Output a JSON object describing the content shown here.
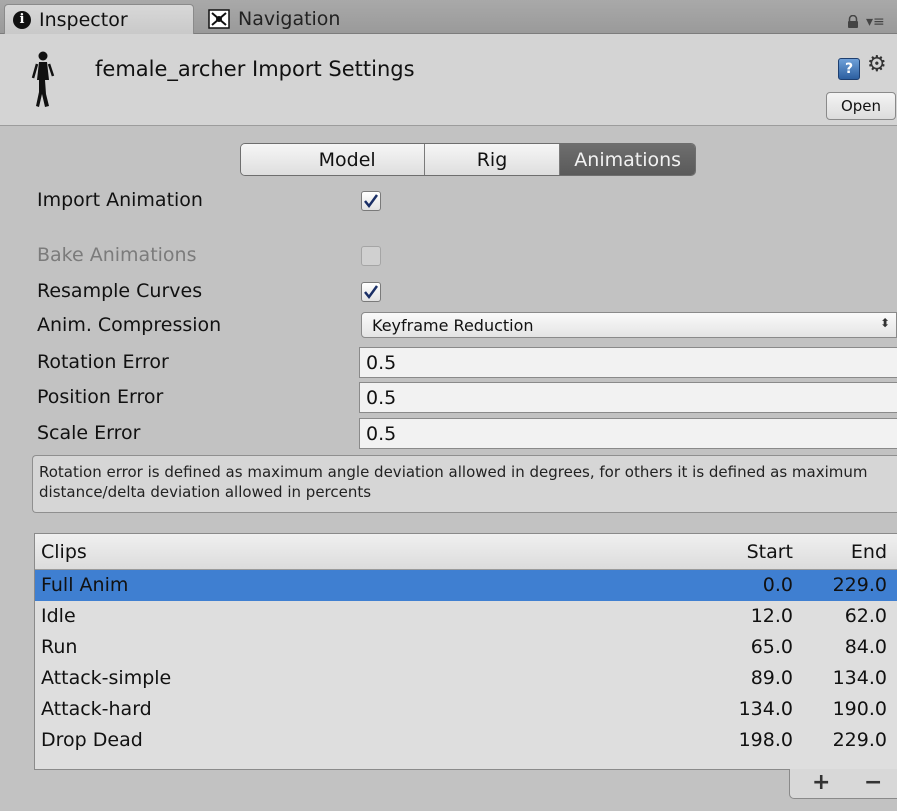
{
  "tabs": [
    {
      "label": "Inspector",
      "icon": "info-icon",
      "active": true
    },
    {
      "label": "Navigation",
      "icon": "navigation-icon",
      "active": false
    }
  ],
  "header": {
    "title": "female_archer Import Settings",
    "open_label": "Open",
    "help_glyph": "?"
  },
  "segments": [
    {
      "label": "Model",
      "active": false
    },
    {
      "label": "Rig",
      "active": false
    },
    {
      "label": "Animations",
      "active": true
    }
  ],
  "properties": {
    "import_animation": {
      "label": "Import Animation",
      "checked": true
    },
    "bake_animations": {
      "label": "Bake Animations",
      "checked": false,
      "disabled": true
    },
    "resample_curves": {
      "label": "Resample Curves",
      "checked": true
    },
    "anim_compression": {
      "label": "Anim. Compression",
      "value": "Keyframe Reduction"
    },
    "rotation_error": {
      "label": "Rotation Error",
      "value": "0.5"
    },
    "position_error": {
      "label": "Position Error",
      "value": "0.5"
    },
    "scale_error": {
      "label": "Scale Error",
      "value": "0.5"
    }
  },
  "info_text": "Rotation error is defined as maximum angle deviation allowed in degrees, for others it is defined as maximum distance/delta deviation allowed in percents",
  "clips": {
    "headers": {
      "name": "Clips",
      "start": "Start",
      "end": "End"
    },
    "rows": [
      {
        "name": "Full Anim",
        "start": "0.0",
        "end": "229.0",
        "selected": true
      },
      {
        "name": "Idle",
        "start": "12.0",
        "end": "62.0",
        "selected": false
      },
      {
        "name": "Run",
        "start": "65.0",
        "end": "84.0",
        "selected": false
      },
      {
        "name": "Attack-simple",
        "start": "89.0",
        "end": "134.0",
        "selected": false
      },
      {
        "name": "Attack-hard",
        "start": "134.0",
        "end": "190.0",
        "selected": false
      },
      {
        "name": "Drop Dead",
        "start": "198.0",
        "end": "229.0",
        "selected": false
      }
    ],
    "add_label": "+",
    "remove_label": "−"
  },
  "colors": {
    "selection": "#3f7fd1",
    "active_segment": "#626262",
    "panel_bg": "#c2c2c2"
  }
}
